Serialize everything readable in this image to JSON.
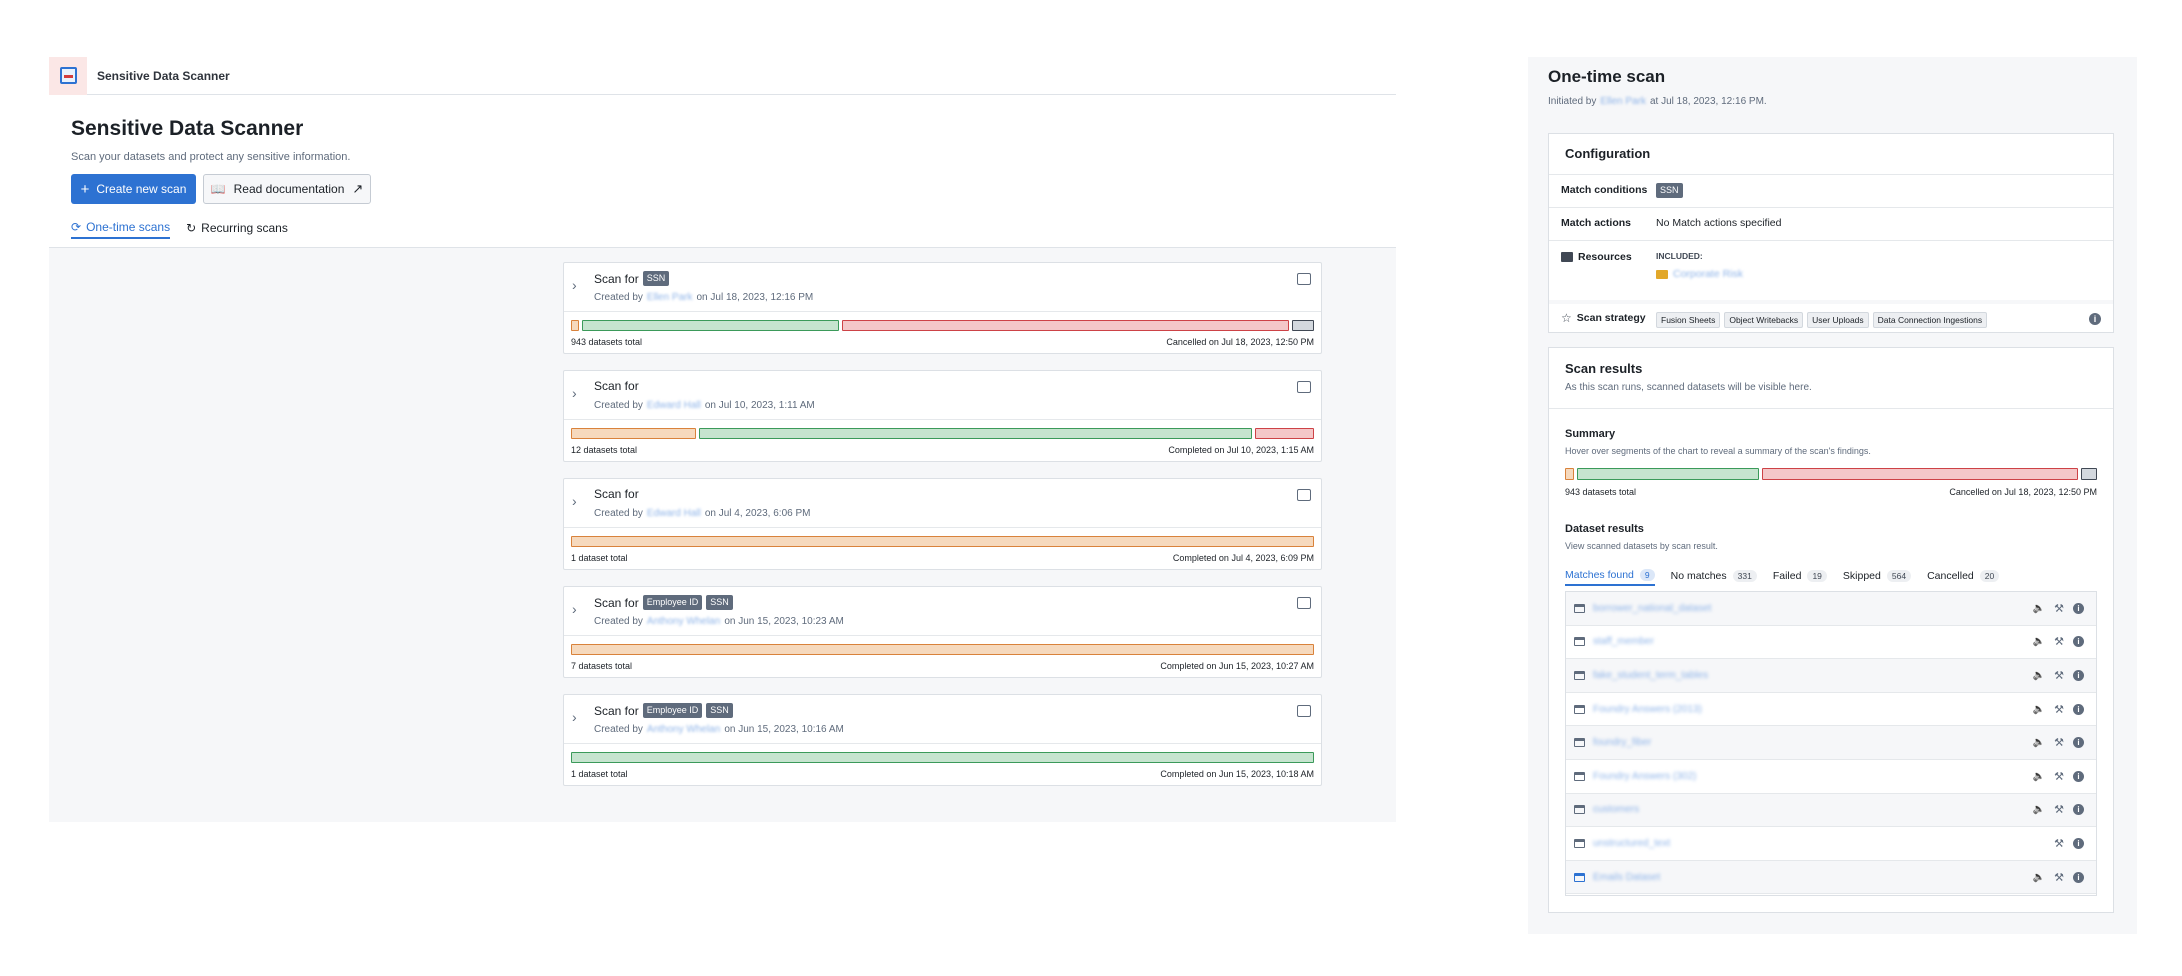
{
  "app": {
    "name": "Sensitive Data Scanner",
    "title": "Sensitive Data Scanner",
    "subtitle": "Scan your datasets and protect any sensitive information.",
    "create_button": "Create new scan",
    "docs_button": "Read documentation",
    "tabs": [
      {
        "label": "One-time scans",
        "active": true
      },
      {
        "label": "Recurring scans",
        "active": false
      }
    ]
  },
  "colors": {
    "accent": "#2d72d2",
    "matches": "#f6d9bd",
    "no_matches": "#c6e4cf",
    "failed": "#f4c7c8",
    "skipped": "#d3d8de"
  },
  "scans": [
    {
      "label": "Scan for",
      "tags": [
        "SSN"
      ],
      "created_prefix": "Created by",
      "user": "Ellen Park",
      "created_suffix": "on Jul 18, 2023, 12:16 PM",
      "total": "943 datasets total",
      "status": "Cancelled on Jul 18, 2023, 12:50 PM",
      "segments": [
        {
          "kind": "matches",
          "share": 0.01
        },
        {
          "kind": "nomatch",
          "share": 0.35
        },
        {
          "kind": "failed",
          "share": 0.61
        },
        {
          "kind": "skipped",
          "share": 0.03
        }
      ]
    },
    {
      "label": "Scan for",
      "tags": [],
      "created_prefix": "Created by",
      "user": "Edward Hall",
      "created_suffix": "on Jul 10, 2023, 1:11 AM",
      "total": "12 datasets total",
      "status": "Completed on Jul 10, 2023, 1:15 AM",
      "segments": [
        {
          "kind": "matches",
          "share": 0.17
        },
        {
          "kind": "nomatch",
          "share": 0.75
        },
        {
          "kind": "failed",
          "share": 0.08
        }
      ]
    },
    {
      "label": "Scan for",
      "tags": [],
      "created_prefix": "Created by",
      "user": "Edward Hall",
      "created_suffix": "on Jul 4, 2023, 6:06 PM",
      "total": "1 dataset total",
      "status": "Completed on Jul 4, 2023, 6:09 PM",
      "segments": [
        {
          "kind": "matches",
          "share": 1.0
        }
      ]
    },
    {
      "label": "Scan for",
      "tags": [
        "Employee ID",
        "SSN"
      ],
      "created_prefix": "Created by",
      "user": "Anthony Whelan",
      "created_suffix": "on Jun 15, 2023, 10:23 AM",
      "total": "7 datasets total",
      "status": "Completed on Jun 15, 2023, 10:27 AM",
      "segments": [
        {
          "kind": "matches",
          "share": 1.0
        }
      ]
    },
    {
      "label": "Scan for",
      "tags": [
        "Employee ID",
        "SSN"
      ],
      "created_prefix": "Created by",
      "user": "Anthony Whelan",
      "created_suffix": "on Jun 15, 2023, 10:16 AM",
      "total": "1 dataset total",
      "status": "Completed on Jun 15, 2023, 10:18 AM",
      "segments": [
        {
          "kind": "nomatch",
          "share": 1.0
        }
      ]
    }
  ],
  "detail": {
    "title": "One-time scan",
    "initiated_prefix": "Initiated by",
    "initiated_user": "Ellen Park",
    "initiated_suffix": "at Jul 18, 2023, 12:16 PM.",
    "configuration": {
      "title": "Configuration",
      "match_conditions_label": "Match conditions",
      "match_conditions_tag": "SSN",
      "match_actions_label": "Match actions",
      "match_actions_value": "No Match actions specified",
      "resources_label": "Resources",
      "included_label": "INCLUDED:",
      "resource_name": "Corporate Risk",
      "strategy_label": "Scan strategy",
      "strategy_tags": [
        "Fusion Sheets",
        "Object Writebacks",
        "User Uploads",
        "Data Connection Ingestions"
      ]
    },
    "results": {
      "title": "Scan results",
      "subtitle": "As this scan runs, scanned datasets will be visible here.",
      "summary_title": "Summary",
      "summary_note": "Hover over segments of the chart to reveal a summary of the scan's findings.",
      "summary_total": "943 datasets total",
      "summary_status": "Cancelled on Jul 18, 2023, 12:50 PM",
      "summary_segments": [
        {
          "kind": "matches",
          "share": 0.01
        },
        {
          "kind": "nomatch",
          "share": 0.35
        },
        {
          "kind": "failed",
          "share": 0.61
        },
        {
          "kind": "skipped",
          "share": 0.03
        }
      ],
      "dataset_title": "Dataset results",
      "dataset_note": "View scanned datasets by scan result.",
      "tabs": [
        {
          "label": "Matches found",
          "count": "9",
          "active": true
        },
        {
          "label": "No matches",
          "count": "331",
          "active": false
        },
        {
          "label": "Failed",
          "count": "19",
          "active": false
        },
        {
          "label": "Skipped",
          "count": "564",
          "active": false
        },
        {
          "label": "Cancelled",
          "count": "20",
          "active": false
        }
      ],
      "datasets": [
        {
          "name": "borrower_national_dataset",
          "speaker": true
        },
        {
          "name": "staff_member",
          "speaker": true
        },
        {
          "name": "fake_student_term_tables",
          "speaker": true
        },
        {
          "name": "Foundry Answers (2013)",
          "speaker": true
        },
        {
          "name": "foundry_fiber",
          "speaker": true
        },
        {
          "name": "Foundry Answers (302)",
          "speaker": true
        },
        {
          "name": "customers",
          "speaker": true
        },
        {
          "name": "unstructured_text",
          "speaker": false
        },
        {
          "name": "Emails Dataset",
          "speaker": true
        }
      ]
    }
  }
}
